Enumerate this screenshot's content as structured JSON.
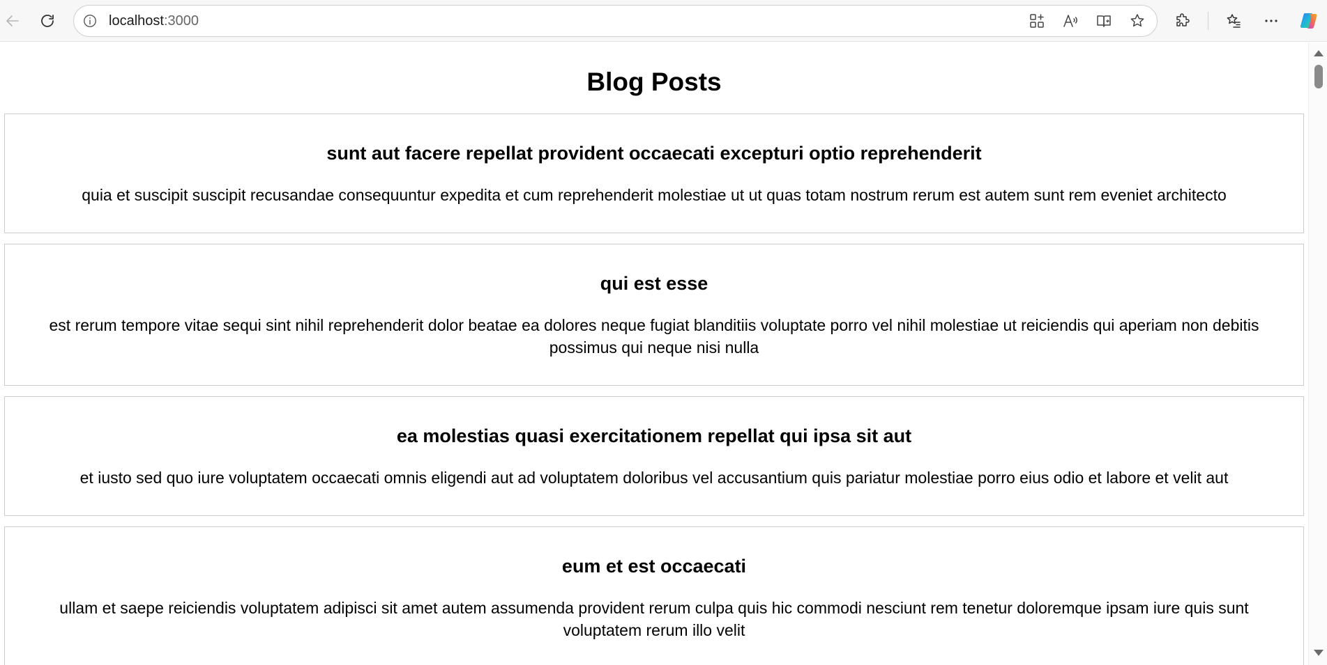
{
  "browser": {
    "url_host": "localhost",
    "url_port": ":3000"
  },
  "page": {
    "title": "Blog Posts"
  },
  "posts": [
    {
      "title": "sunt aut facere repellat provident occaecati excepturi optio reprehenderit",
      "body": "quia et suscipit suscipit recusandae consequuntur expedita et cum reprehenderit molestiae ut ut quas totam nostrum rerum est autem sunt rem eveniet architecto"
    },
    {
      "title": "qui est esse",
      "body": "est rerum tempore vitae sequi sint nihil reprehenderit dolor beatae ea dolores neque fugiat blanditiis voluptate porro vel nihil molestiae ut reiciendis qui aperiam non debitis possimus qui neque nisi nulla"
    },
    {
      "title": "ea molestias quasi exercitationem repellat qui ipsa sit aut",
      "body": "et iusto sed quo iure voluptatem occaecati omnis eligendi aut ad voluptatem doloribus vel accusantium quis pariatur molestiae porro eius odio et labore et velit aut"
    },
    {
      "title": "eum et est occaecati",
      "body": "ullam et saepe reiciendis voluptatem adipisci sit amet autem assumenda provident rerum culpa quis hic commodi nesciunt rem tenetur doloremque ipsam iure quis sunt voluptatem rerum illo velit"
    }
  ]
}
